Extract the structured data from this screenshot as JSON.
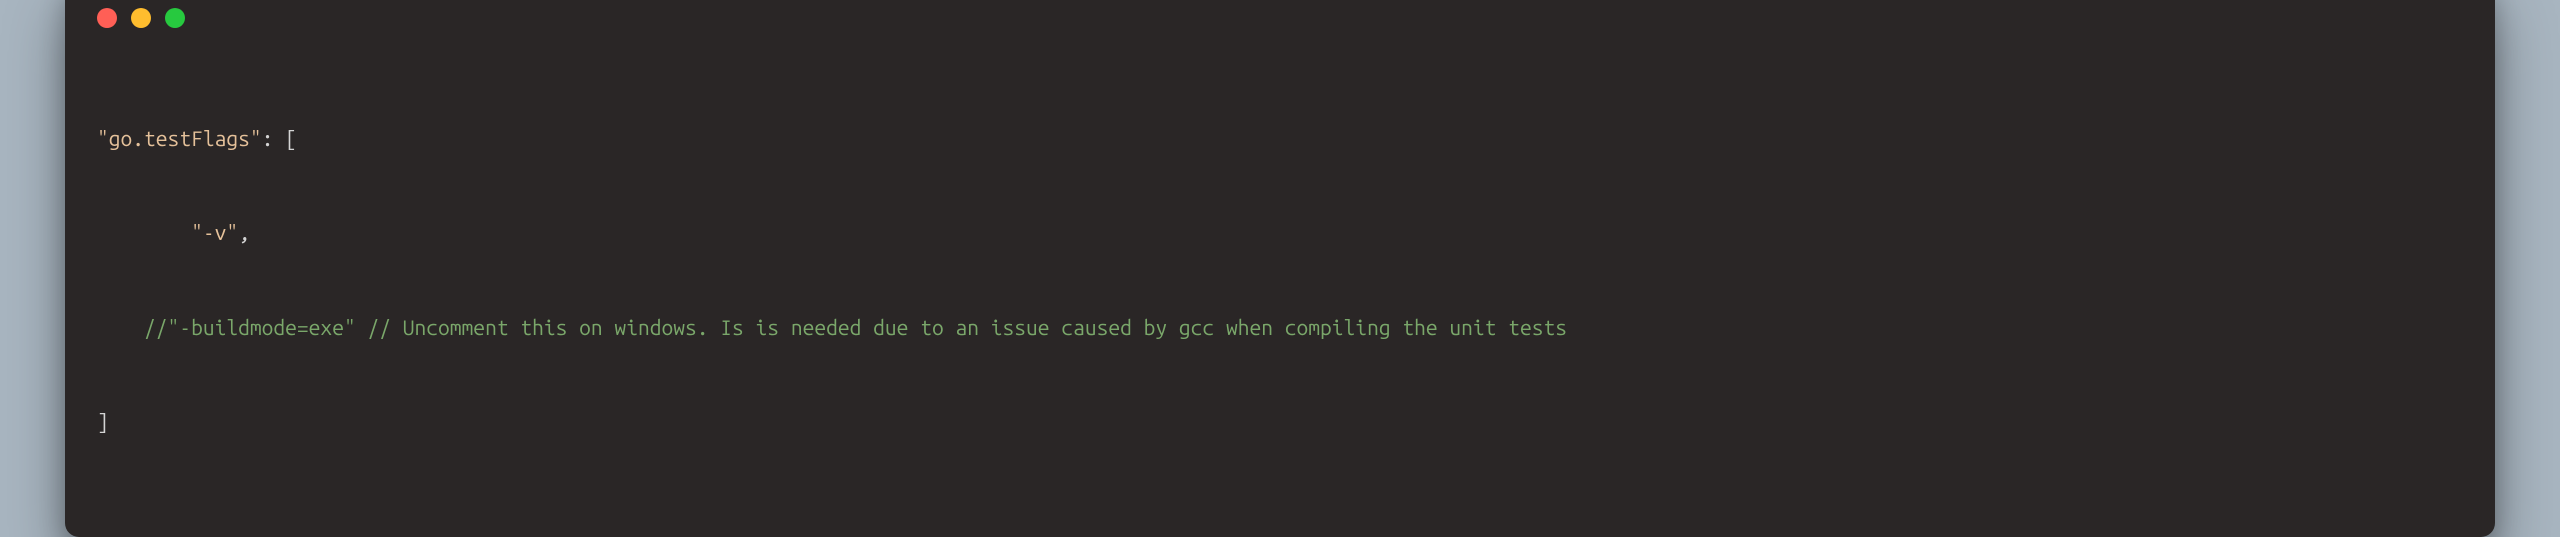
{
  "code": {
    "key": "\"go.testFlags\"",
    "colon_open": ": [",
    "flag_value": "\"-v\"",
    "comma": ",",
    "comment_line": "//\"-buildmode=exe\" // Uncomment this on windows. Is is needed due to an issue caused by gcc when compiling the unit tests",
    "close": "]"
  },
  "colors": {
    "background": "#a8b5c0",
    "window_bg": "#2a2626",
    "red": "#ff5f56",
    "yellow": "#ffbd2e",
    "green": "#27c93f",
    "key_string": "#e5c19a",
    "comment": "#7aa76a",
    "punct": "#d4d4d4"
  }
}
